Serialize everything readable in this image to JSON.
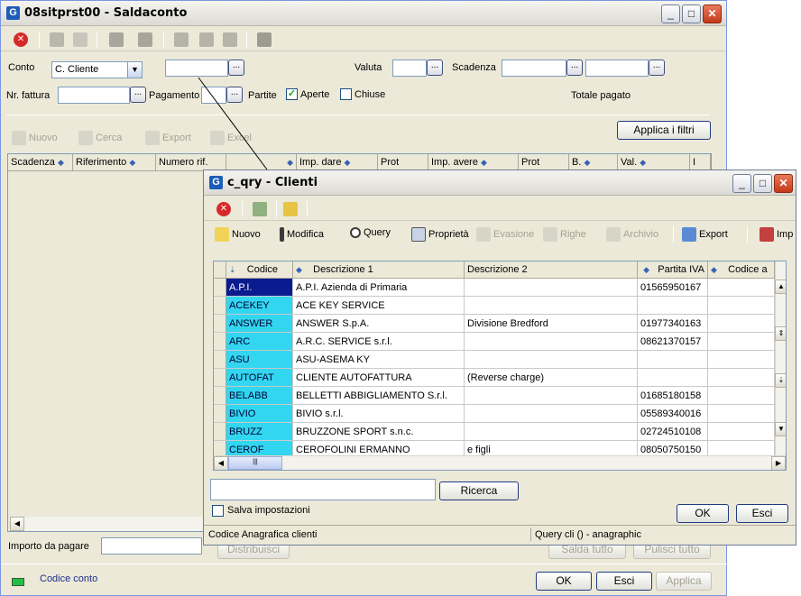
{
  "main": {
    "title": "08sitprst00 - Saldaconto",
    "conto_label": "Conto",
    "conto_value": "C. Cliente",
    "valuta_label": "Valuta",
    "scadenza_label": "Scadenza",
    "nr_fattura_label": "Nr. fattura",
    "pagamento_label": "Pagamento",
    "partite_label": "Partite",
    "aperte_label": "Aperte",
    "chiuse_label": "Chiuse",
    "totale_pagato_label": "Totale pagato",
    "applica_filtri_label": "Applica i filtri",
    "ellipsis": "...",
    "commands": {
      "nuovo": "Nuovo",
      "cerca": "Cerca",
      "export": "Export",
      "excel": "Excel"
    },
    "columns": [
      "Scadenza",
      "Riferimento",
      "Numero rif.",
      "",
      "Imp. dare",
      "Prot",
      "Imp. avere",
      "Prot",
      "B.",
      "Val.",
      "I"
    ],
    "importo_label": "Importo da pagare",
    "distribuisci_label": "Distribuisci",
    "salda_tutto_label": "Salda tutto",
    "pulisci_tutto_label": "Pulisci tutto",
    "status_text": "Codice conto",
    "ok_label": "OK",
    "esci_label": "Esci",
    "applica_label": "Applica"
  },
  "popup": {
    "title": "c_qry - Clienti",
    "commands": {
      "nuovo": "Nuovo",
      "modifica": "Modifica",
      "query": "Query",
      "proprieta": "Proprietà",
      "evasione": "Evasione",
      "righe": "Righe",
      "archivio": "Archivio",
      "export": "Export",
      "imp": "Imp"
    },
    "columns": [
      "Codice",
      "Descrizione 1",
      "Descrizione 2",
      "Partita IVA",
      "Codice a"
    ],
    "rows": [
      {
        "codice": "A.P.I.",
        "desc1": "A.P.I. Azienda di Primaria",
        "desc2": "",
        "piva": "01565950167"
      },
      {
        "codice": "ACEKEY",
        "desc1": "ACE KEY SERVICE",
        "desc2": "",
        "piva": ""
      },
      {
        "codice": "ANSWER",
        "desc1": "ANSWER S.p.A.",
        "desc2": "Divisione Bredford",
        "piva": "01977340163"
      },
      {
        "codice": "ARC",
        "desc1": "A.R.C. SERVICE s.r.l.",
        "desc2": "",
        "piva": "08621370157"
      },
      {
        "codice": "ASU",
        "desc1": "ASU-ASEMA KY",
        "desc2": "",
        "piva": ""
      },
      {
        "codice": "AUTOFAT",
        "desc1": "CLIENTE AUTOFATTURA",
        "desc2": "(Reverse charge)",
        "piva": ""
      },
      {
        "codice": "BELABB",
        "desc1": "BELLETTI ABBIGLIAMENTO S.r.l.",
        "desc2": "",
        "piva": "01685180158"
      },
      {
        "codice": "BIVIO",
        "desc1": "BIVIO s.r.l.",
        "desc2": "",
        "piva": "05589340016"
      },
      {
        "codice": "BRUZZ",
        "desc1": "BRUZZONE SPORT s.n.c.",
        "desc2": "",
        "piva": "02724510108"
      },
      {
        "codice": "CEROF",
        "desc1": "CEROFOLINI ERMANNO",
        "desc2": "e figli",
        "piva": "08050750150"
      }
    ],
    "search_value": "",
    "ricerca_label": "Ricerca",
    "salva_label": "Salva impostazioni",
    "ok_label": "OK",
    "esci_label": "Esci",
    "status_left": "Codice Anagrafica clienti",
    "status_right": "Query cli () - anagraphic"
  }
}
